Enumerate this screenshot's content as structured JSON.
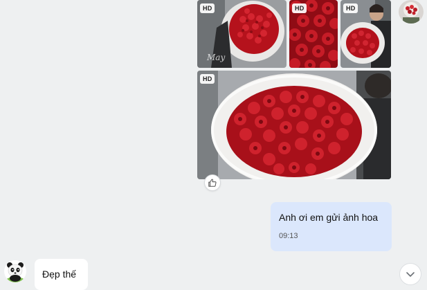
{
  "photos": [
    {
      "name": "photo-1",
      "badge": "HD",
      "watermark": "May"
    },
    {
      "name": "photo-2",
      "badge": "HD"
    },
    {
      "name": "photo-3",
      "badge": "HD"
    },
    {
      "name": "photo-4",
      "badge": "HD"
    }
  ],
  "outgoing_message": {
    "text": "Anh ơi em gửi ảnh hoa",
    "time": "09:13"
  },
  "incoming_message": {
    "text": "Đẹp thế"
  },
  "icons": {
    "like": "thumbs-up-icon",
    "scroll": "chevron-down-icon"
  },
  "colors": {
    "background": "#eef0f1",
    "outgoing_bubble": "#dbe7fc",
    "incoming_bubble": "#ffffff",
    "rose_red": "#b0141d"
  }
}
